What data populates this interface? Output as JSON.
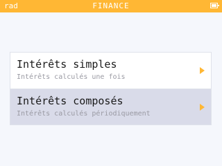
{
  "status_bar": {
    "angle_mode": "rad",
    "title": "FINANCE",
    "battery_icon": "battery-icon"
  },
  "menu": {
    "items": [
      {
        "title": "Intérêts simples",
        "subtitle": "Intérêts calculés une fois",
        "icon": "chevron-right-icon",
        "selected": false
      },
      {
        "title": "Intérêts composés",
        "subtitle": "Intérêts calculés périodiquement",
        "icon": "chevron-right-icon",
        "selected": true
      }
    ]
  },
  "colors": {
    "accent": "#ffb734",
    "background": "#f5f7fc",
    "selected_row": "#d9dbe9",
    "subtitle_text": "#9a9aa3"
  }
}
